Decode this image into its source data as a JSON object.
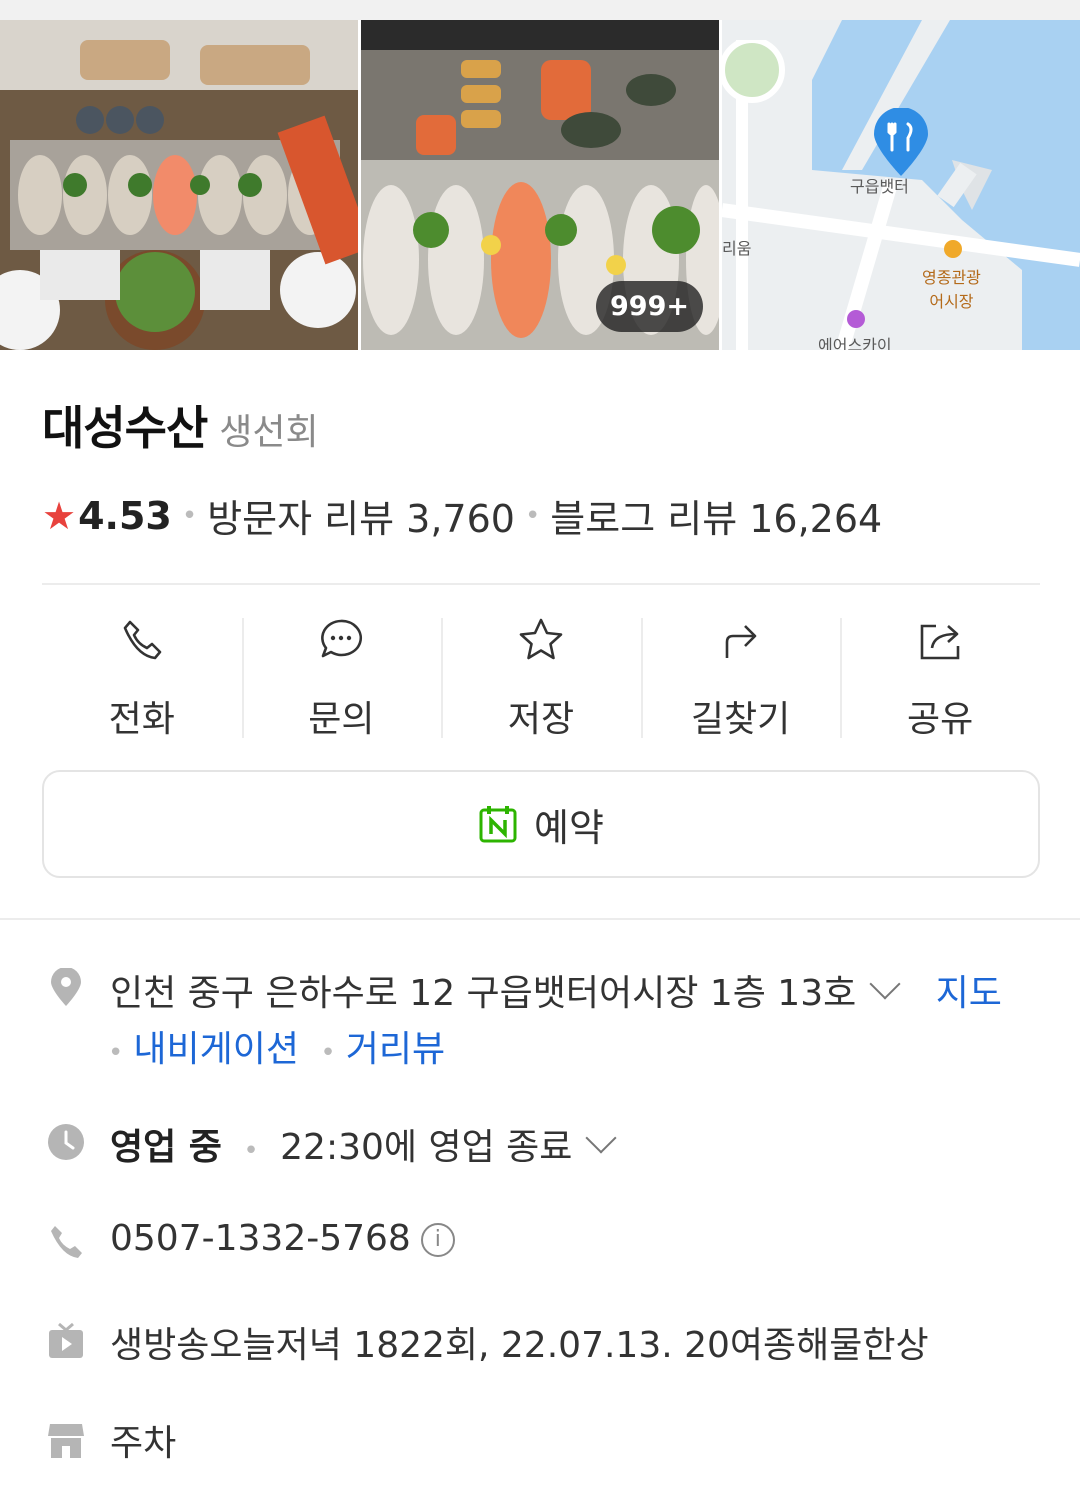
{
  "place": {
    "name": "대성수산",
    "category": "생선회",
    "rating": "4.53",
    "visitor_reviews": "방문자 리뷰 3,760",
    "blog_reviews": "블로그 리뷰 16,264"
  },
  "photos": {
    "count_badge": "999+"
  },
  "map": {
    "pin_label": "구읍뱃터",
    "label_market": "영종관광\n어시장",
    "label_sky": "에어스카이",
    "label_left": "리움"
  },
  "actions": [
    {
      "label": "전화",
      "icon": "phone-icon"
    },
    {
      "label": "문의",
      "icon": "chat-icon"
    },
    {
      "label": "저장",
      "icon": "star-icon"
    },
    {
      "label": "길찾기",
      "icon": "directions-icon"
    },
    {
      "label": "공유",
      "icon": "share-icon"
    }
  ],
  "reserve": {
    "label": "예약",
    "icon": "naver-calendar-icon"
  },
  "info": {
    "address": "인천 중구 은하수로 12 구읍뱃터어시장 1층 13호",
    "map_link": "지도",
    "nav_link": "내비게이션",
    "street_link": "거리뷰",
    "status": "영업 중",
    "hours": "22:30에 영업 종료",
    "phone": "0507-1332-5768",
    "tv": "생방송오늘저녁 1822회, 22.07.13. 20여종해물한상",
    "parking": "주차"
  },
  "colors": {
    "accent_blue": "#1d67d6",
    "star_red": "#e8423d",
    "naver_green": "#2db400",
    "map_pin": "#2f8de4"
  }
}
